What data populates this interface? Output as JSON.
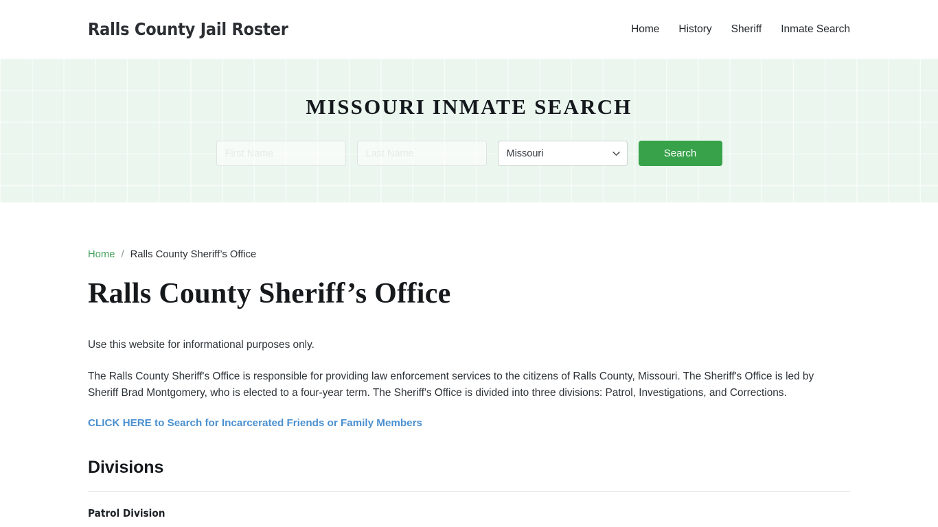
{
  "header": {
    "brand": "Ralls County Jail Roster",
    "nav": [
      {
        "label": "Home"
      },
      {
        "label": "History"
      },
      {
        "label": "Sheriff"
      },
      {
        "label": "Inmate Search"
      }
    ]
  },
  "hero": {
    "title": "MISSOURI INMATE SEARCH",
    "first_name_placeholder": "First Name",
    "first_name_value": "",
    "last_name_placeholder": "Last Name",
    "last_name_value": "",
    "state_selected": "Missouri",
    "state_options": [
      "Missouri"
    ],
    "search_button": "Search",
    "accent_color": "#37a24a",
    "background_color": "#eaf6ee"
  },
  "breadcrumb": {
    "home": "Home",
    "separator": "/",
    "current": "Ralls County Sheriff’s Office"
  },
  "main": {
    "page_title": "Ralls County Sheriff’s Office",
    "lead": "Use this website for informational purposes only.",
    "paragraph": "The Ralls County Sheriff's Office is responsible for providing law enforcement services to the citizens of Ralls County, Missouri. The Sheriff's Office is led by Sheriff Brad Montgomery, who is elected to a four-year term. The Sheriff's Office is divided into three divisions: Patrol, Investigations, and Corrections.",
    "cta_link": "CLICK HERE to Search for Incarcerated Friends or Family Members",
    "cta_link_color": "#4a90d0",
    "divisions_heading": "Divisions",
    "divisions": [
      {
        "name": "Patrol Division"
      }
    ]
  }
}
